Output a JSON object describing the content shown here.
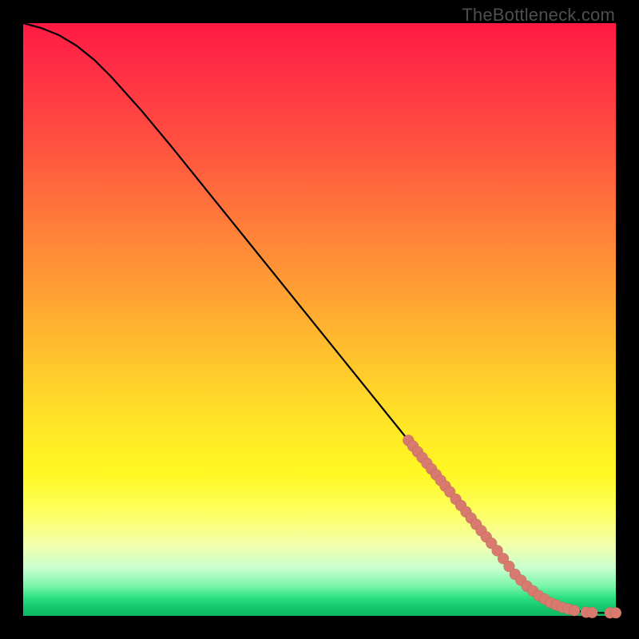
{
  "watermark": "TheBottleneck.com",
  "colors": {
    "dot": "#d87a6e",
    "line": "#000000",
    "frame": "#000000"
  },
  "chart_data": {
    "type": "line",
    "title": "",
    "xlabel": "",
    "ylabel": "",
    "xlim": [
      0,
      100
    ],
    "ylim": [
      0,
      100
    ],
    "grid": false,
    "legend": false,
    "series": [
      {
        "name": "curve",
        "x": [
          0,
          3,
          6,
          9,
          12,
          15,
          20,
          25,
          30,
          35,
          40,
          45,
          50,
          55,
          60,
          65,
          70,
          75,
          80,
          83,
          85,
          87,
          89,
          91,
          93,
          95,
          97,
          99,
          100
        ],
        "y": [
          100,
          99.2,
          98.0,
          96.2,
          93.8,
          90.8,
          85.2,
          79.2,
          73.0,
          66.8,
          60.6,
          54.4,
          48.2,
          42.0,
          35.8,
          29.6,
          23.4,
          17.2,
          11.0,
          7.0,
          5.0,
          3.4,
          2.2,
          1.4,
          0.9,
          0.6,
          0.5,
          0.5,
          0.5
        ]
      }
    ],
    "marker_clusters": [
      {
        "x_start": 65,
        "x_end": 72,
        "count": 10
      },
      {
        "x_start": 73,
        "x_end": 79,
        "count": 8
      },
      {
        "x_start": 80,
        "x_end": 85,
        "count": 6
      },
      {
        "x_start": 86,
        "x_end": 90,
        "count": 5
      },
      {
        "x_start": 91,
        "x_end": 93,
        "count": 3
      },
      {
        "x_start": 95,
        "x_end": 96,
        "count": 2
      },
      {
        "x_start": 99,
        "x_end": 100,
        "count": 2
      }
    ],
    "marker_radius_px": 7
  }
}
